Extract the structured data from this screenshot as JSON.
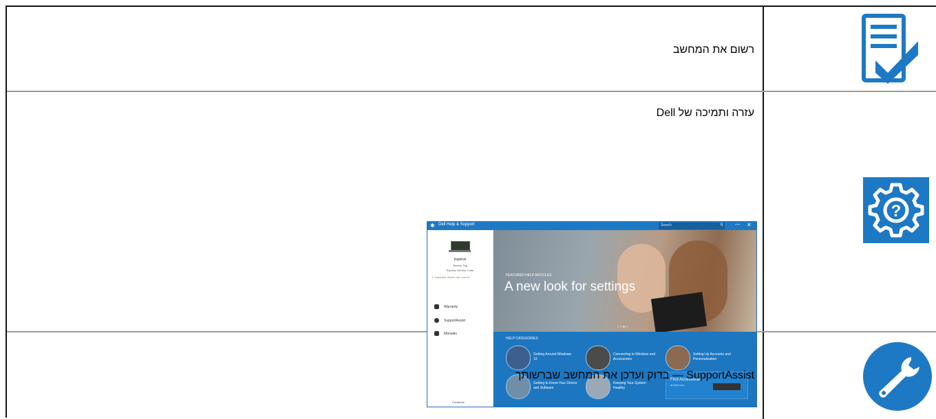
{
  "rows": [
    {
      "text": "רשום את המחשב",
      "icon": "register-checklist-icon"
    },
    {
      "text": "עזרה ותמיכה של Dell",
      "icon": "help-gear-icon"
    },
    {
      "text": "SupportAssist — בדוק ועדכן את המחשב שברשותך",
      "icon": "wrench-icon"
    }
  ],
  "colors": {
    "icon_blue": "#1e79c4",
    "border": "#111111",
    "row_rule": "#9a9a9a"
  },
  "screenshot": {
    "app_title": "Dell Help & Support",
    "search_placeholder": "Search",
    "search_icon": "q",
    "minimize": "—",
    "close": "✕",
    "sidebar": {
      "device_name": "Inspiron",
      "service_tag": "Service Tag",
      "express_code": "Express Service Code",
      "drivers_status": "✔ Important drivers are current",
      "links": [
        "Warranty",
        "SupportAssist",
        "Manuals"
      ],
      "feedback": "Feedback"
    },
    "hero": {
      "kicker": "FEATURED HELP ARTICLES",
      "title": "A new look for settings",
      "dots": "○○●○"
    },
    "help_categories": {
      "title": "HELP CATEGORIES",
      "items": [
        "Getting Around Windows 10",
        "Connecting to Wireless and Accessories",
        "Setting Up Accounts and Personalization",
        "Getting to Know Your Device and Software",
        "Keeping Your System Healthy"
      ],
      "accessories_title": "Find Accessories",
      "accessories_sub": "at Dell.com"
    }
  }
}
